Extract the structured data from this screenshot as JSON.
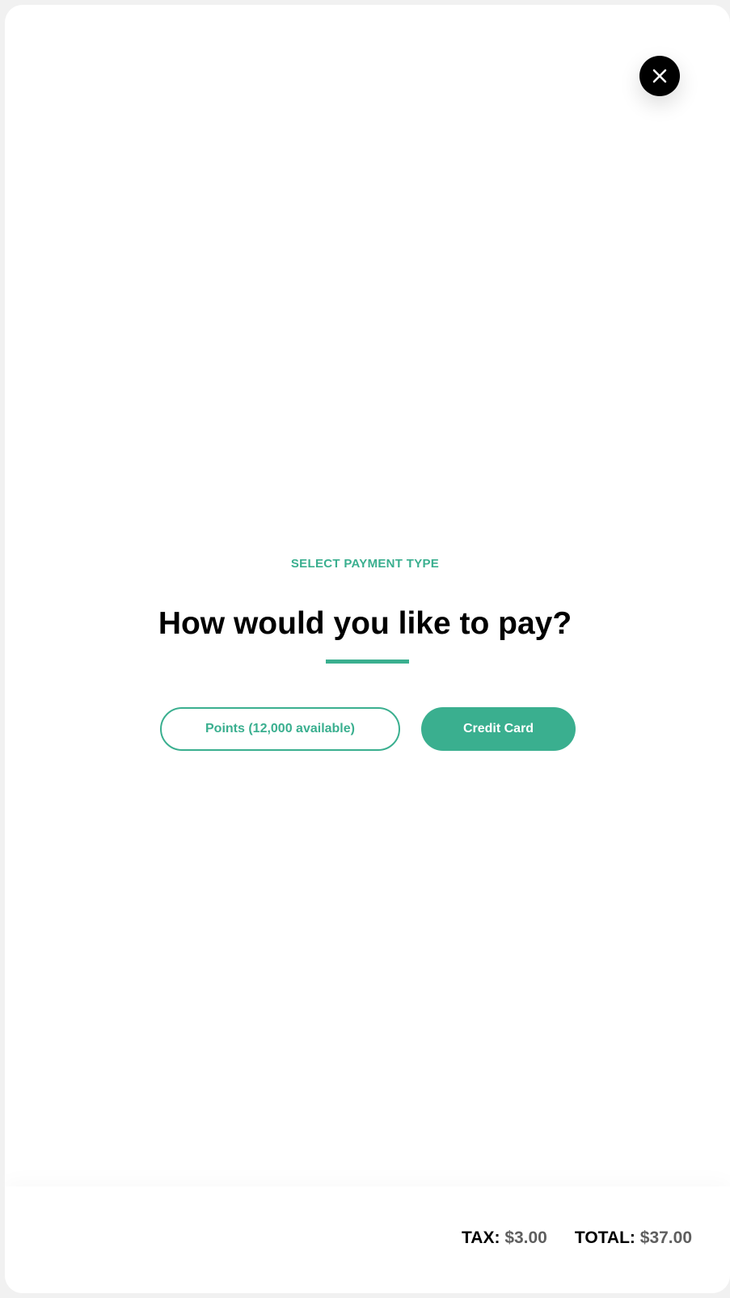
{
  "colors": {
    "accent": "#3aaf8f",
    "close_button": "#000000",
    "muted_value": "#5f5f5f"
  },
  "close_button": {
    "icon": "close-icon"
  },
  "payment": {
    "eyebrow": "SELECT PAYMENT TYPE",
    "title": "How would you like to pay?",
    "options": [
      {
        "label": "Points (12,000 available)"
      },
      {
        "label": "Credit Card"
      }
    ]
  },
  "footer": {
    "tax_label": "TAX:",
    "tax_value": "$3.00",
    "total_label": "TOTAL:",
    "total_value": "$37.00"
  }
}
